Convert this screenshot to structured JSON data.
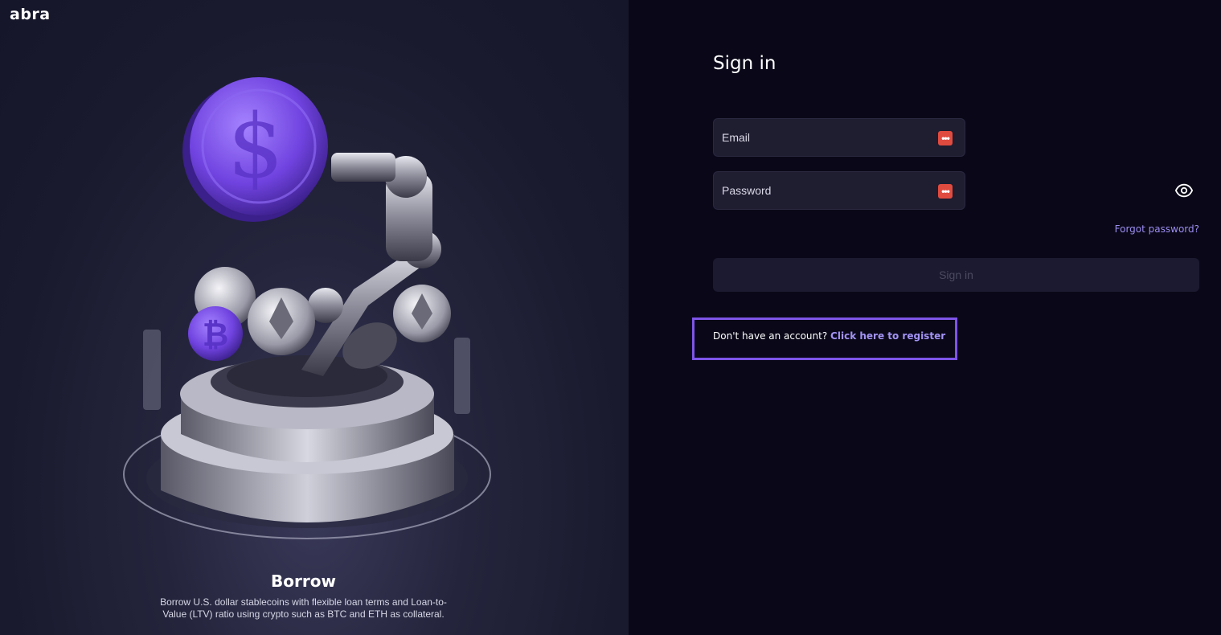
{
  "brand": {
    "logo_text": "abra"
  },
  "hero": {
    "title": "Borrow",
    "description": "Borrow U.S. dollar stablecoins with flexible loan terms and Loan-to-Value (LTV) ratio using crypto such as BTC and ETH as collateral."
  },
  "signin": {
    "title": "Sign in",
    "email_placeholder": "Email",
    "password_placeholder": "Password",
    "forgot_password": "Forgot password?",
    "submit_label": "Sign in",
    "register_prompt": "Don't have an account?",
    "register_link": "Click here to register"
  },
  "icons": {
    "password_manager": "password-manager-icon",
    "show_password": "eye-icon"
  },
  "colors": {
    "accent": "#7d54e8",
    "link": "#9b8cf0",
    "password_manager": "#e04b3f",
    "background": "#0a0818"
  }
}
